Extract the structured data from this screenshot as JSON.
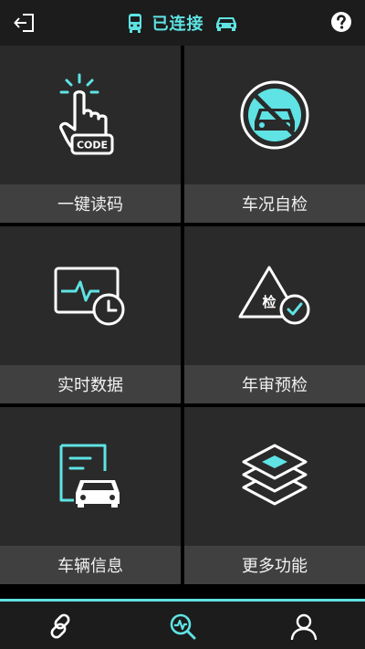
{
  "header": {
    "status": "已连接",
    "colors": {
      "accent": "#5fe3e4",
      "bar": "#1c1c1c"
    },
    "icons": {
      "back": "exit-icon",
      "status_left": "bus-icon",
      "status_right": "car-icon",
      "help": "help-icon"
    }
  },
  "tiles": [
    {
      "label": "一键读码",
      "icon": "tap-code-icon",
      "icon_text": "CODE"
    },
    {
      "label": "车况自检",
      "icon": "car-no-sign-icon"
    },
    {
      "label": "实时数据",
      "icon": "monitor-clock-icon"
    },
    {
      "label": "年审预检",
      "icon": "triangle-check-icon",
      "icon_text": "检"
    },
    {
      "label": "车辆信息",
      "icon": "document-car-icon"
    },
    {
      "label": "更多功能",
      "icon": "layers-icon"
    }
  ],
  "nav": {
    "tabs": [
      {
        "icon": "link-icon",
        "active": false
      },
      {
        "icon": "diagnose-search-icon",
        "active": true
      },
      {
        "icon": "user-icon",
        "active": false
      }
    ]
  }
}
